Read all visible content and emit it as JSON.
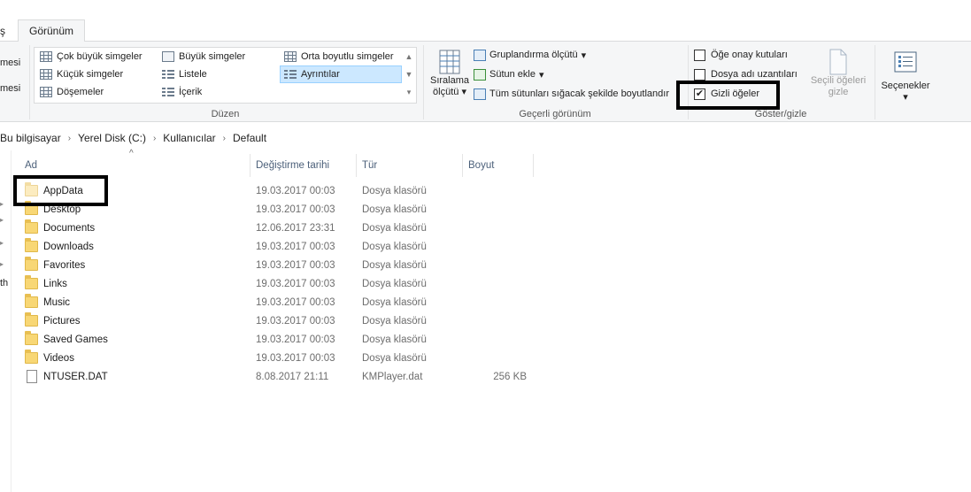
{
  "tabs": {
    "cut_label": "ş",
    "active_label": "Görünüm"
  },
  "ribbon": {
    "left_edge": [
      "mesi",
      "mesi"
    ],
    "layout": {
      "group_label": "Düzen",
      "items": [
        {
          "label": "Çok büyük simgeler",
          "icon": "extra-large-icons-icon"
        },
        {
          "label": "Küçük simgeler",
          "icon": "small-icons-icon"
        },
        {
          "label": "Döşemeler",
          "icon": "tiles-icon"
        },
        {
          "label": "Büyük simgeler",
          "icon": "large-icons-icon"
        },
        {
          "label": "Listele",
          "icon": "list-icon"
        },
        {
          "label": "İçerik",
          "icon": "content-icon"
        },
        {
          "label": "Orta boyutlu simgeler",
          "icon": "medium-icons-icon"
        },
        {
          "label": "Ayrıntılar",
          "icon": "details-icon",
          "selected": true
        }
      ]
    },
    "current_view": {
      "group_label": "Geçerli görünüm",
      "sort_line1": "Sıralama",
      "sort_line2": "ölçütü",
      "group_by": "Gruplandırma ölçütü",
      "add_column": "Sütun ekle",
      "fit_columns": "Tüm sütunları sığacak şekilde boyutlandır"
    },
    "show_hide": {
      "group_label": "Göster/gizle",
      "checkboxes": [
        {
          "label": "Öğe onay kutuları",
          "checked": false
        },
        {
          "label": "Dosya adı uzantıları",
          "checked": false
        },
        {
          "label": "Gizli öğeler",
          "checked": true
        }
      ],
      "hide_selected_line1": "Seçili öğeleri",
      "hide_selected_line2": "gizle"
    },
    "options_label": "Seçenekler"
  },
  "breadcrumb": [
    "Bu bilgisayar",
    "Yerel Disk (C:)",
    "Kullanıcılar",
    "Default"
  ],
  "nav_pane_partial_text": "th",
  "file_list": {
    "columns": [
      "Ad",
      "Değiştirme tarihi",
      "Tür",
      "Boyut"
    ],
    "rows": [
      {
        "name": "AppData",
        "date": "19.03.2017 00:03",
        "type": "Dosya klasörü",
        "size": "",
        "kind": "folder-hidden"
      },
      {
        "name": "Desktop",
        "date": "19.03.2017 00:03",
        "type": "Dosya klasörü",
        "size": "",
        "kind": "folder"
      },
      {
        "name": "Documents",
        "date": "12.06.2017 23:31",
        "type": "Dosya klasörü",
        "size": "",
        "kind": "folder"
      },
      {
        "name": "Downloads",
        "date": "19.03.2017 00:03",
        "type": "Dosya klasörü",
        "size": "",
        "kind": "folder"
      },
      {
        "name": "Favorites",
        "date": "19.03.2017 00:03",
        "type": "Dosya klasörü",
        "size": "",
        "kind": "folder"
      },
      {
        "name": "Links",
        "date": "19.03.2017 00:03",
        "type": "Dosya klasörü",
        "size": "",
        "kind": "folder"
      },
      {
        "name": "Music",
        "date": "19.03.2017 00:03",
        "type": "Dosya klasörü",
        "size": "",
        "kind": "folder"
      },
      {
        "name": "Pictures",
        "date": "19.03.2017 00:03",
        "type": "Dosya klasörü",
        "size": "",
        "kind": "folder"
      },
      {
        "name": "Saved Games",
        "date": "19.03.2017 00:03",
        "type": "Dosya klasörü",
        "size": "",
        "kind": "folder"
      },
      {
        "name": "Videos",
        "date": "19.03.2017 00:03",
        "type": "Dosya klasörü",
        "size": "",
        "kind": "folder"
      },
      {
        "name": "NTUSER.DAT",
        "date": "8.08.2017 21:11",
        "type": "KMPlayer.dat",
        "size": "256 KB",
        "kind": "file"
      }
    ]
  }
}
